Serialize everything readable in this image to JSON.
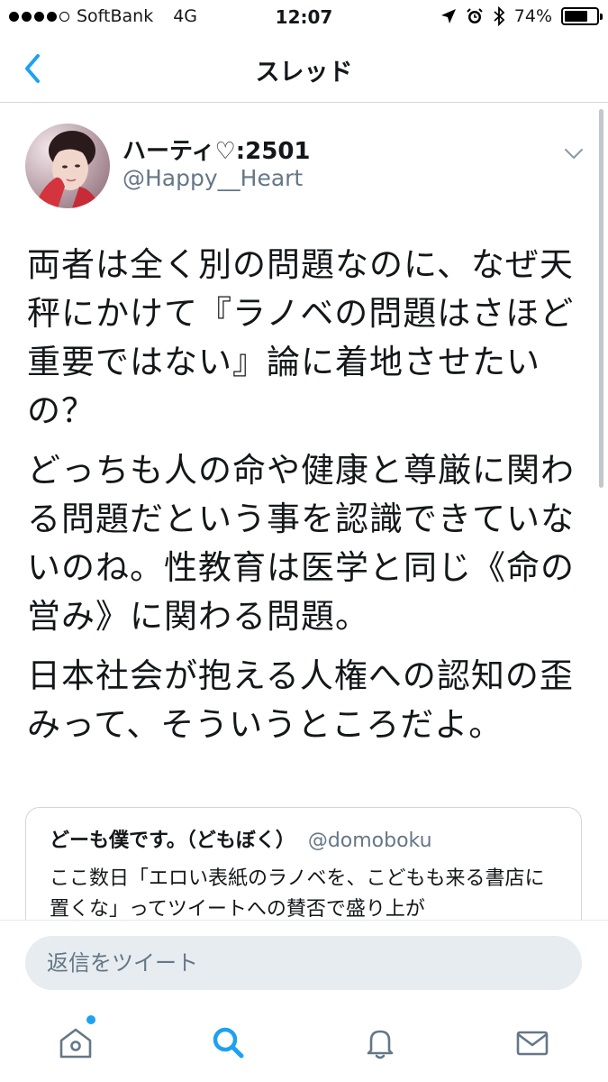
{
  "status_bar": {
    "carrier": "SoftBank",
    "network": "4G",
    "time": "12:07",
    "battery": "74%",
    "battery_level": 0.74
  },
  "nav": {
    "title": "スレッド",
    "back_icon": "chevron-left-icon"
  },
  "tweet": {
    "display_name": "ハーティ♡:2501",
    "handle": "@Happy__Heart",
    "paragraphs": [
      "両者は全く別の問題なのに、なぜ天秤にかけて『ラノベの問題はさほど重要ではない』論に着地させたいの？",
      "どっちも人の命や健康と尊厳に関わる問題だという事を認識できていないのね。性教育は医学と同じ《命の営み》に関わる問題。",
      "日本社会が抱える人権への認知の歪みって、そういうところだよ。"
    ]
  },
  "quoted_tweet": {
    "display_name": "どーも僕です。（どもぼく）",
    "handle": "@domoboku",
    "text": "ここ数日「エロい表紙のラノベを、こどもも来る書店に置くな」ってツイートへの賛否で盛り上が"
  },
  "reply": {
    "placeholder": "返信をツイート"
  },
  "tabs": [
    {
      "name": "home",
      "icon": "home-icon",
      "has_notification": true
    },
    {
      "name": "search",
      "icon": "search-icon",
      "active": true
    },
    {
      "name": "notifications",
      "icon": "bell-icon"
    },
    {
      "name": "messages",
      "icon": "mail-icon"
    }
  ],
  "colors": {
    "accent": "#1da1f2",
    "text": "#14171a",
    "secondary_text": "#657786",
    "divider": "#d0d6dc"
  }
}
